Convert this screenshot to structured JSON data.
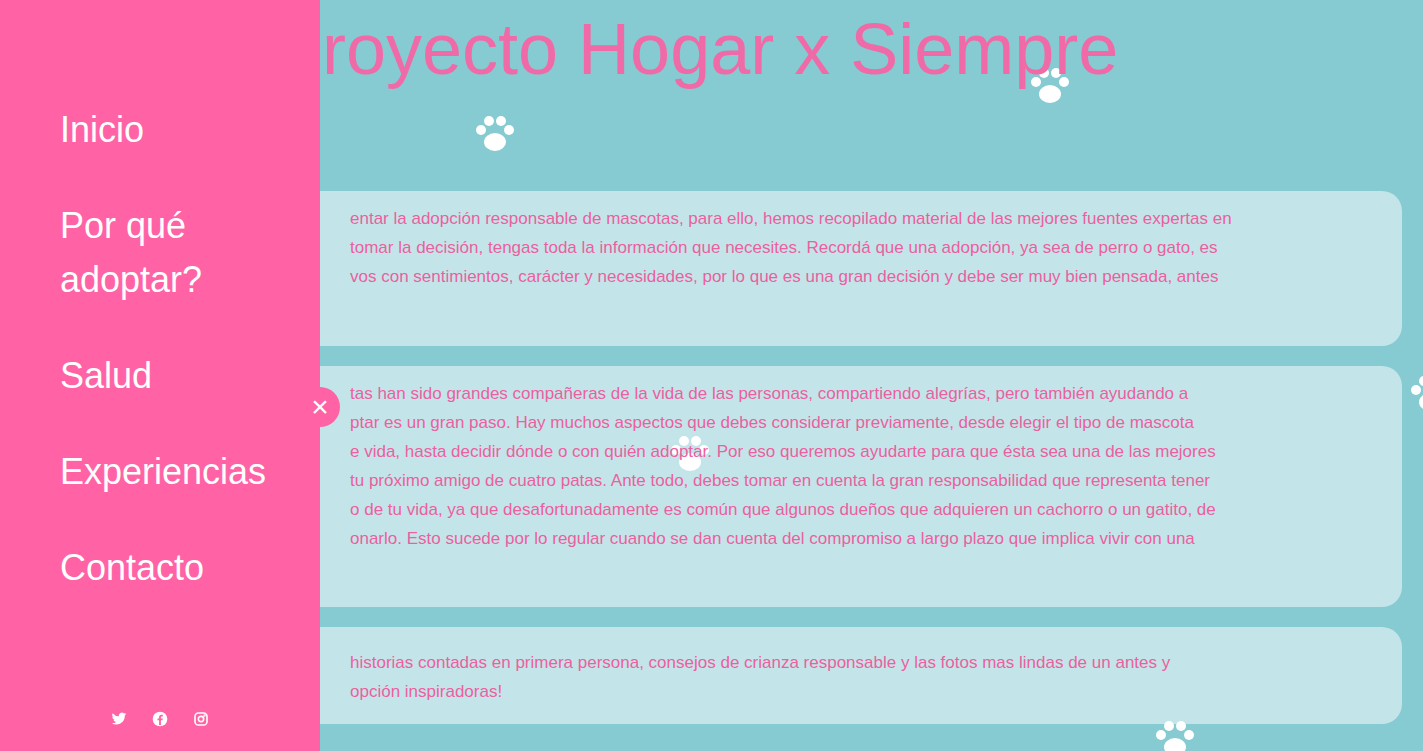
{
  "site": {
    "title": "royecto Hogar x Siempre"
  },
  "sidebar": {
    "items": [
      {
        "label": "Inicio"
      },
      {
        "label": "Por qué adoptar?"
      },
      {
        "label": "Salud"
      },
      {
        "label": "Experiencias"
      },
      {
        "label": "Contacto"
      }
    ],
    "close": "×"
  },
  "cards": [
    {
      "lines": [
        "entar la adopción responsable de mascotas, para ello, hemos recopilado material de las mejores fuentes expertas en",
        "tomar la decisión, tengas toda la información que necesites. Recordá que una adopción, ya sea de perro o gato, es",
        "vos con sentimientos, carácter y necesidades, por lo que es una gran decisión y debe ser muy bien pensada, antes"
      ]
    },
    {
      "lines": [
        "tas han sido grandes compañeras de la vida de las personas, compartiendo alegrías, pero también ayudando a",
        "ptar es un gran paso. Hay muchos aspectos que debes considerar previamente, desde elegir el tipo de mascota",
        "e vida, hasta decidir dónde o con quién adoptar. Por eso queremos ayudarte para que ésta sea una de las mejores",
        "tu próximo amigo de cuatro patas. Ante todo, debes tomar en cuenta la gran responsabilidad que representa tener",
        "o de tu vida, ya que desafortunadamente es común que algunos dueños que adquieren un cachorro o un gatito, de",
        "onarlo. Esto sucede por lo regular cuando se dan cuenta del compromiso a largo plazo que implica vivir con una"
      ]
    },
    {
      "lines": [
        "historias contadas en primera persona, consejos de crianza responsable y las fotos mas lindas de un antes y",
        "opción inspiradoras!"
      ]
    }
  ]
}
